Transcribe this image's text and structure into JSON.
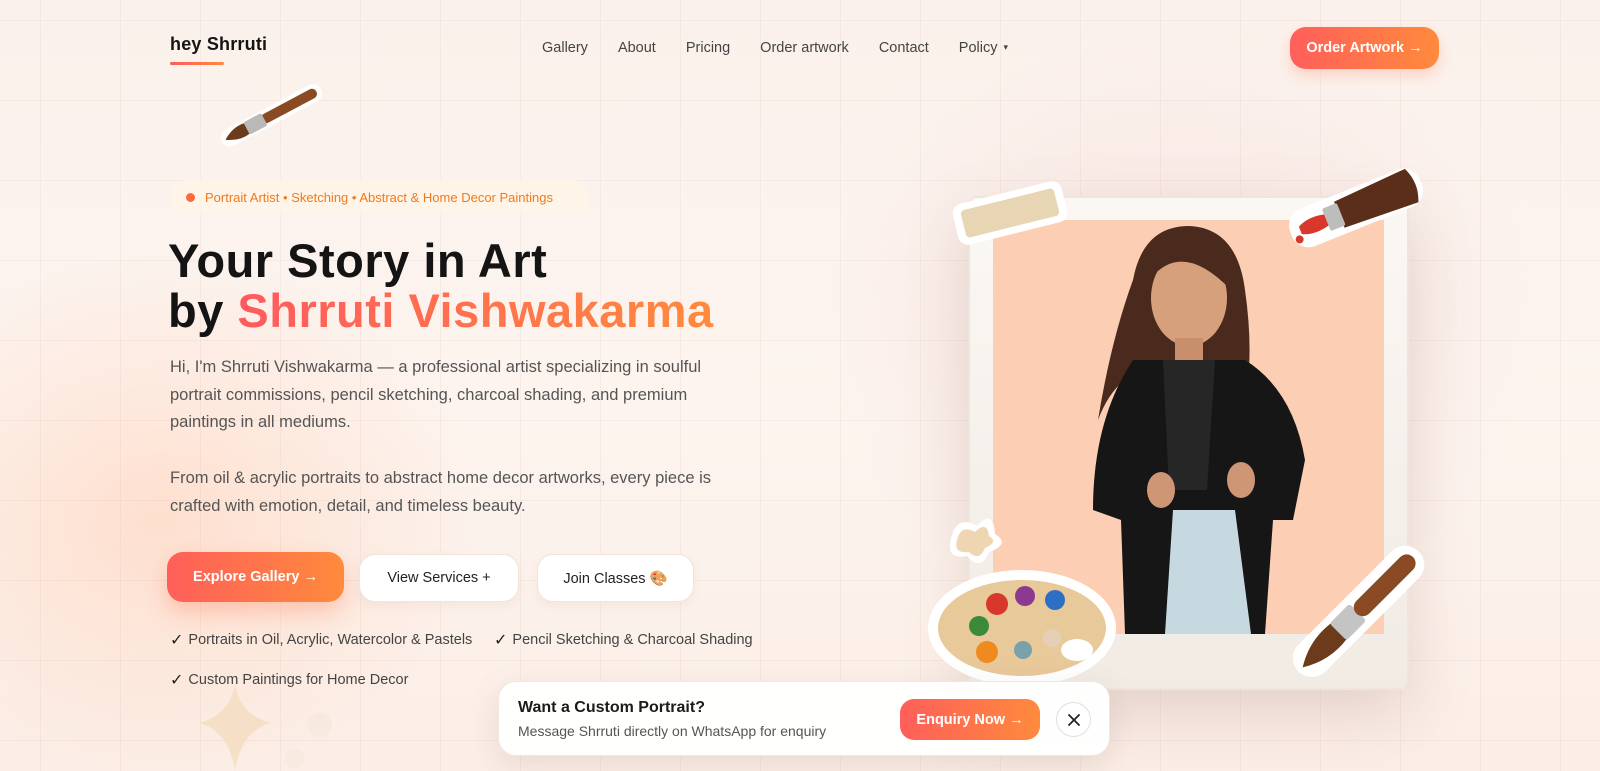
{
  "brand": {
    "logo": "hey Shrruti"
  },
  "nav": {
    "items": [
      {
        "label": "Gallery"
      },
      {
        "label": "About"
      },
      {
        "label": "Pricing"
      },
      {
        "label": "Order artwork"
      },
      {
        "label": "Contact"
      },
      {
        "label": "Policy",
        "caret": "▾"
      }
    ],
    "cta": "Order Artwork →"
  },
  "hero": {
    "tag": "Portrait Artist • Sketching • Abstract & Home Decor Paintings",
    "title_line1": "Your Story in Art",
    "title_by": "by ",
    "title_name": "Shrruti Vishwakarma",
    "para1": "Hi, I'm Shrruti Vishwakarma — a professional artist specializing in soulful portrait commissions, pencil sketching, charcoal shading, and premium paintings in all mediums.",
    "para2": "From oil & acrylic portraits to abstract home decor artworks, every piece is crafted with emotion, detail, and timeless beauty.",
    "buttons": {
      "explore": "Explore Gallery →",
      "services": "View Services +",
      "classes": "Join Classes 🎨"
    },
    "checks": [
      "Portraits in Oil, Acrylic, Watercolor & Pastels",
      "Pencil Sketching & Charcoal Shading",
      "Custom Paintings for Home Decor"
    ],
    "check_mark": "✓"
  },
  "popup": {
    "title": "Want a Custom Portrait?",
    "subtitle": "Message Shrruti directly on WhatsApp for enquiry",
    "cta": "Enquiry Now →"
  },
  "colors": {
    "accent_start": "#ff5f5a",
    "accent_end": "#ff8a3c",
    "tag_text": "#f07a1e",
    "photo_bg": "#fccfb4"
  },
  "icons": [
    "paintbrush-icon",
    "paint-tube-icon",
    "palette-icon",
    "close-icon",
    "tape-icon",
    "sparkle-icon"
  ]
}
